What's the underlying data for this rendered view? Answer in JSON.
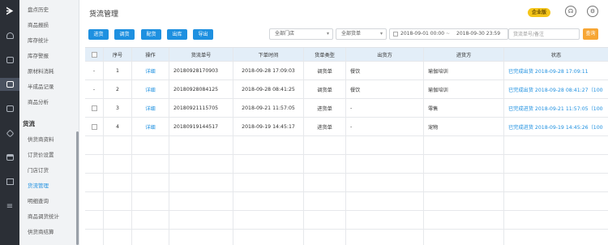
{
  "sidebar": {
    "items": [
      {
        "label": "盘点历史"
      },
      {
        "label": "商品报损"
      },
      {
        "label": "库存统计"
      },
      {
        "label": "库存警报"
      },
      {
        "label": "原材料消耗"
      },
      {
        "label": "半成品记录"
      },
      {
        "label": "商品分析"
      }
    ],
    "group": "货流",
    "group_items": [
      {
        "label": "供货商资料"
      },
      {
        "label": "订货价设置"
      },
      {
        "label": "门店订货"
      },
      {
        "label": "货流管理",
        "active": true
      },
      {
        "label": "明细查询"
      },
      {
        "label": "商品调货统计"
      },
      {
        "label": "供货商结算"
      }
    ]
  },
  "header": {
    "title": "货流管理",
    "badge": "企业版",
    "headset_icon": "headset-icon",
    "settings_icon": "gear-icon"
  },
  "toolbar": {
    "buttons": [
      "进货",
      "调货",
      "配货",
      "出库",
      "导出"
    ],
    "store_select": "全部门店",
    "type_select": "全部货单",
    "date_from": "2018-09-01 00:00",
    "date_to": "2018-09-30 23:59",
    "date_sep": "~",
    "search_placeholder": "货流单号/备注",
    "search_button": "查询"
  },
  "table": {
    "columns": [
      "序号",
      "操作",
      "货流单号",
      "下单时间",
      "货单类型",
      "出货方",
      "进货方",
      "状态"
    ],
    "rows": [
      {
        "seq": "1",
        "op": "详细",
        "no": "20180928170903",
        "time": "2018-09-28 17:09:03",
        "type": "调货单",
        "from": "餐饮",
        "to": "瑜伽培训",
        "status": "已完成出货 2018-09-28 17:09:11",
        "check": "-"
      },
      {
        "seq": "2",
        "op": "详细",
        "no": "20180928084125",
        "time": "2018-09-28 08:41:25",
        "type": "调货单",
        "from": "餐饮",
        "to": "瑜伽培训",
        "status": "已完成出货 2018-09-28 08:41:27（100",
        "check": "-"
      },
      {
        "seq": "3",
        "op": "详细",
        "no": "20180921115705",
        "time": "2018-09-21 11:57:05",
        "type": "进货单",
        "from": "-",
        "to": "零售",
        "status": "已完成进货 2018-09-21 11:57:05（100",
        "check": ""
      },
      {
        "seq": "4",
        "op": "详细",
        "no": "20180919144517",
        "time": "2018-09-19 14:45:17",
        "type": "进货单",
        "from": "-",
        "to": "宠物",
        "status": "已完成进货 2018-09-19 14:45:26（100",
        "check": ""
      }
    ]
  },
  "colors": {
    "accent": "#1e90e0",
    "badge": "#f5c518",
    "search_button": "#f7a634",
    "rail": "#2b2f36"
  }
}
